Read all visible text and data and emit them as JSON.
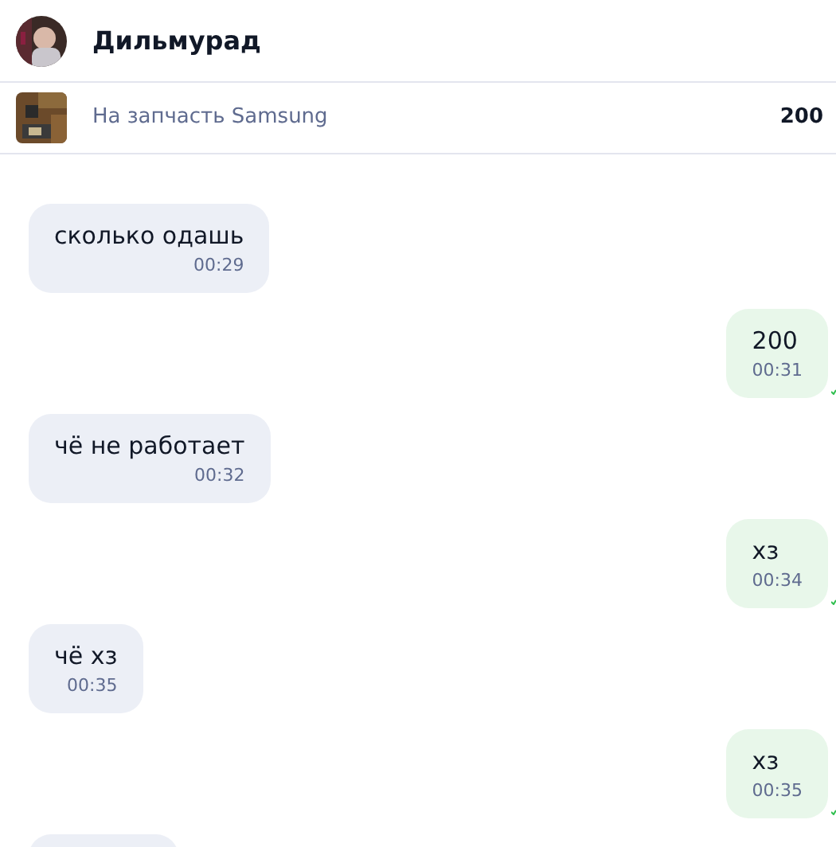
{
  "contact": {
    "name": "Дильмурад"
  },
  "listing": {
    "title": "На запчасть Samsung",
    "price": "200"
  },
  "messages": [
    {
      "kind": "incoming",
      "text": "сколько одашь",
      "time": "00:29"
    },
    {
      "kind": "outgoing",
      "text": "200",
      "time": "00:31"
    },
    {
      "kind": "incoming",
      "text": "чё не работает",
      "time": "00:32"
    },
    {
      "kind": "outgoing",
      "text": "хз",
      "time": "00:34"
    },
    {
      "kind": "incoming",
      "text": "чё хз",
      "time": "00:35"
    },
    {
      "kind": "outgoing",
      "text": "хз",
      "time": "00:35"
    }
  ]
}
